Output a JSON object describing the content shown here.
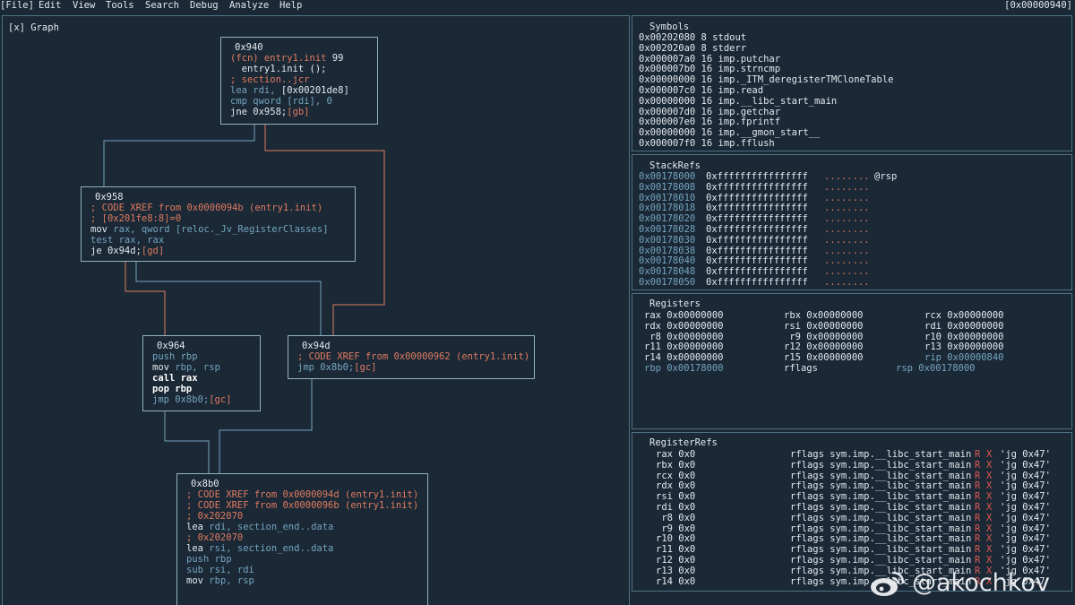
{
  "menu": {
    "items": [
      "[File]",
      "Edit",
      "View",
      "Tools",
      "Search",
      "Debug",
      "Analyze",
      "Help"
    ],
    "address": "[0x00000940]"
  },
  "graph": {
    "title": "[x] Graph",
    "nodes": {
      "n940": {
        "header": "0x940",
        "lines": [
          {
            "cls": "c-or",
            "text": "(fcn) entry1.init ",
            "tail": "99",
            "tailcls": "c-wh"
          },
          {
            "cls": "c-wh",
            "text": "  entry1.init ();"
          },
          {
            "cls": "c-or",
            "text": "; section..jcr"
          },
          {
            "cls": "c-bl",
            "text": "lea rdi, ",
            "tail": "[0x00201de8]",
            "tailcls": "c-wh"
          },
          {
            "cls": "c-bl",
            "text": "cmp qword ",
            "tail": "[rdi], 0",
            "tailcls": "c-bl"
          },
          {
            "cls": "c-wh",
            "text": "jne 0x958;",
            "tail": "[gb]",
            "tailcls": "c-or"
          }
        ]
      },
      "n958": {
        "header": "0x958",
        "lines": [
          {
            "cls": "c-or",
            "text": "; CODE XREF from 0x0000094b (entry1.init)"
          },
          {
            "cls": "c-or",
            "text": "; [0x201fe8:8]=0"
          },
          {
            "cls": "c-wh",
            "text": "mov ",
            "tail": "rax, qword [reloc._Jv_RegisterClasses]",
            "tailcls": "c-bl"
          },
          {
            "cls": "c-bl",
            "text": "test rax, rax"
          },
          {
            "cls": "c-wh",
            "text": "je 0x94d;",
            "tail": "[gd]",
            "tailcls": "c-or"
          }
        ]
      },
      "n964": {
        "header": "0x964",
        "lines": [
          {
            "cls": "c-bl",
            "text": "push rbp"
          },
          {
            "cls": "c-wh",
            "text": "mov ",
            "tail": "rbp, rsp",
            "tailcls": "c-bl"
          },
          {
            "cls": "c-bold",
            "text": "call rax"
          },
          {
            "cls": "c-bold",
            "text": "pop rbp"
          },
          {
            "cls": "c-bl",
            "text": "jmp 0x8b0;",
            "tail": "[gc]",
            "tailcls": "c-or"
          }
        ]
      },
      "n94d": {
        "header": "0x94d",
        "lines": [
          {
            "cls": "c-or",
            "text": "; CODE XREF from 0x00000962 (entry1.init)"
          },
          {
            "cls": "c-bl",
            "text": "jmp 0x8b0;",
            "tail": "[gc]",
            "tailcls": "c-or"
          }
        ]
      },
      "n8b0": {
        "header": "0x8b0",
        "lines": [
          {
            "cls": "c-or",
            "text": "; CODE XREF from 0x0000094d (entry1.init)"
          },
          {
            "cls": "c-or",
            "text": "; CODE XREF from 0x0000096b (entry1.init)"
          },
          {
            "cls": "c-or",
            "text": "; 0x202070"
          },
          {
            "cls": "c-wh",
            "text": "lea ",
            "tail": "rdi, section_end..data",
            "tailcls": "c-bl"
          },
          {
            "cls": "c-or",
            "text": "; 0x202070"
          },
          {
            "cls": "c-wh",
            "text": "lea ",
            "tail": "rsi, section_end..data",
            "tailcls": "c-bl"
          },
          {
            "cls": "c-bl",
            "text": "push rbp"
          },
          {
            "cls": "c-bl",
            "text": "sub rsi, rdi"
          },
          {
            "cls": "c-wh",
            "text": "mov ",
            "tail": "rbp, rsp",
            "tailcls": "c-bl"
          }
        ]
      }
    }
  },
  "symbols": {
    "title": "Symbols",
    "rows": [
      "0x00202080 8 stdout",
      "0x002020a0 8 stderr",
      "0x000007a0 16 imp.putchar",
      "0x000007b0 16 imp.strncmp",
      "0x00000000 16 imp._ITM_deregisterTMCloneTable",
      "0x000007c0 16 imp.read",
      "0x00000000 16 imp.__libc_start_main",
      "0x000007d0 16 imp.getchar",
      "0x000007e0 16 imp.fprintf",
      "0x00000000 16 imp.__gmon_start__",
      "0x000007f0 16 imp.fflush"
    ]
  },
  "stackrefs": {
    "title": "StackRefs",
    "rows": [
      {
        "addr": "0x00178000",
        "val": "0xffffffffffffffff",
        "dots": "........",
        "ref": "@rsp"
      },
      {
        "addr": "0x00178008",
        "val": "0xffffffffffffffff",
        "dots": "........",
        "ref": ""
      },
      {
        "addr": "0x00178010",
        "val": "0xffffffffffffffff",
        "dots": "........",
        "ref": ""
      },
      {
        "addr": "0x00178018",
        "val": "0xffffffffffffffff",
        "dots": "........",
        "ref": ""
      },
      {
        "addr": "0x00178020",
        "val": "0xffffffffffffffff",
        "dots": "........",
        "ref": ""
      },
      {
        "addr": "0x00178028",
        "val": "0xffffffffffffffff",
        "dots": "........",
        "ref": ""
      },
      {
        "addr": "0x00178030",
        "val": "0xffffffffffffffff",
        "dots": "........",
        "ref": ""
      },
      {
        "addr": "0x00178038",
        "val": "0xffffffffffffffff",
        "dots": "........",
        "ref": ""
      },
      {
        "addr": "0x00178040",
        "val": "0xffffffffffffffff",
        "dots": "........",
        "ref": ""
      },
      {
        "addr": "0x00178048",
        "val": "0xffffffffffffffff",
        "dots": "........",
        "ref": ""
      },
      {
        "addr": "0x00178050",
        "val": "0xffffffffffffffff",
        "dots": "........",
        "ref": ""
      }
    ]
  },
  "registers": {
    "title": "Registers",
    "rows": [
      [
        "rax 0x00000000",
        "rbx 0x00000000",
        "rcx 0x00000000"
      ],
      [
        "rdx 0x00000000",
        "rsi 0x00000000",
        "rdi 0x00000000"
      ],
      [
        " r8 0x00000000",
        " r9 0x00000000",
        "r10 0x00000000"
      ],
      [
        "r11 0x00000000",
        "r12 0x00000000",
        "r13 0x00000000"
      ],
      [
        "r14 0x00000000",
        "r15 0x00000000",
        "rip 0x00000840"
      ],
      [
        "rbp 0x00178000",
        "rflags",
        "rsp 0x00178000"
      ]
    ]
  },
  "registerrefs": {
    "title": "RegisterRefs",
    "rows": [
      {
        "reg": "rax 0x0"
      },
      {
        "reg": "rbx 0x0"
      },
      {
        "reg": "rcx 0x0"
      },
      {
        "reg": "rdx 0x0"
      },
      {
        "reg": "rsi 0x0"
      },
      {
        "reg": "rdi 0x0"
      },
      {
        "reg": " r8 0x0"
      },
      {
        "reg": " r9 0x0"
      },
      {
        "reg": "r10 0x0"
      },
      {
        "reg": "r11 0x0"
      },
      {
        "reg": "r12 0x0"
      },
      {
        "reg": "r13 0x0"
      },
      {
        "reg": "r14 0x0"
      }
    ],
    "ref_text": "rflags sym.imp.__libc_start_main",
    "perm_r": "R",
    "perm_x": "X",
    "value": "'jg 0x47'"
  },
  "watermark": {
    "handle": "@akochkov",
    "logo_icon": "weibo-logo"
  },
  "colors": {
    "background": "#1b2836",
    "border": "#4e7284",
    "comment": "#df7b60",
    "register": "#74a5bf",
    "edge_true": "#df7b60",
    "edge_false": "#74a5bf"
  }
}
